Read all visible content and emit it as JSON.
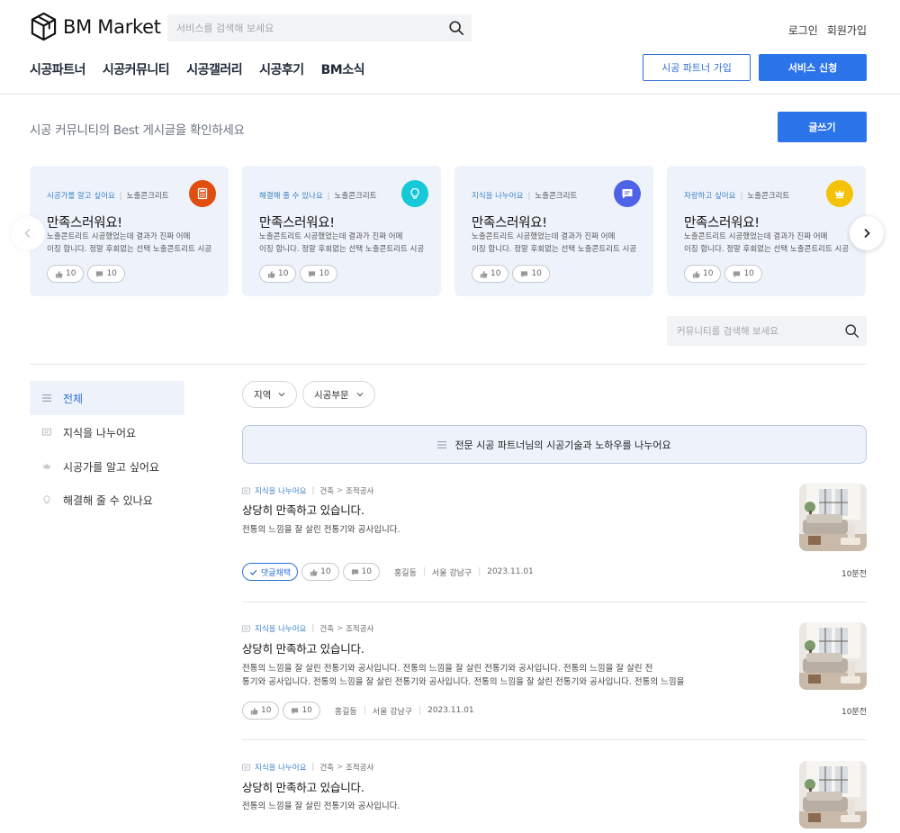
{
  "header": {
    "logo_text": "BM Market",
    "search_placeholder": "서비스를 검색해 보세요",
    "login": "로그인",
    "signup": "회원가입",
    "nav": [
      "시공파트너",
      "시공커뮤니티",
      "시공갤러리",
      "시공후기",
      "BM소식"
    ],
    "partner_button": "시공 파트너 가입",
    "service_button": "서비스 신청"
  },
  "best": {
    "title": "시공 커뮤니티의 Best 게시글을 확인하세요",
    "write_button": "글쓰기",
    "cards": [
      {
        "category": "시공가를 알고 싶어요",
        "tag": "노출콘크리트",
        "icon": "calculator-icon",
        "icon_color": "#e04f10",
        "title": "만족스러워요!",
        "line1": "노출콘트리트 시공했었는데 결과가 진짜 어메",
        "line2": "이징 합니다. 정말 후회없는 선택 노출콘트리트 시공",
        "likes": "10",
        "comments": "10"
      },
      {
        "category": "해결해 줄 수 있나요",
        "tag": "노출콘크리트",
        "icon": "lightbulb-icon",
        "icon_color": "#16c8d8",
        "title": "만족스러워요!",
        "line1": "노출콘트리트 시공했었는데 결과가 진짜 어메",
        "line2": "이징 합니다. 정말 후회없는 선택 노출콘트리트 시공",
        "likes": "10",
        "comments": "10"
      },
      {
        "category": "지식을 나누어요",
        "tag": "노출콘크리트",
        "icon": "chat-icon",
        "icon_color": "#4f63e6",
        "title": "만족스러워요!",
        "line1": "노출콘트리트 시공했었는데 결과가 진짜 어메",
        "line2": "이징 합니다. 정말 후회없는 선택 노출콘트리트 시공",
        "likes": "10",
        "comments": "10"
      },
      {
        "category": "자랑하고 싶어요",
        "tag": "노출콘크리트",
        "icon": "crown-icon",
        "icon_color": "#f5c20a",
        "title": "만족스러워요!",
        "line1": "노출콘트리트 시공했었는데 결과가 진짜 어메",
        "line2": "이징 합니다. 정말 후회없는 선택 노출콘트리트 시공",
        "likes": "10",
        "comments": "10"
      }
    ]
  },
  "community_search_placeholder": "커뮤니티를 검색해 보세요",
  "sidebar": {
    "items": [
      {
        "label": "전체",
        "active": true
      },
      {
        "label": "지식을 나누어요"
      },
      {
        "label": "시공가를 알고 싶어요"
      },
      {
        "label": "해결해 줄 수 있나요"
      }
    ]
  },
  "filters": {
    "region": "지역",
    "category": "시공부문"
  },
  "banner": "전문 시공 파트너님의 시공기술과 노하우를 나누어요",
  "posts": [
    {
      "category": "지식을 나누어요",
      "tag1": "건축",
      "arrow": ">",
      "tag2": "조적공사",
      "title": "상당히 만족하고 있습니다.",
      "line1": "전통의 느낌을 잘 살린 전통기와 공사입니다.",
      "line2": "",
      "adopted": "댓글채택",
      "likes": "10",
      "comments": "10",
      "author": "홍길동",
      "location": "서울 강남구",
      "date": "2023.11.01",
      "time": "10분전"
    },
    {
      "category": "지식을 나누어요",
      "tag1": "건축",
      "arrow": ">",
      "tag2": "조적공사",
      "title": "상당히 만족하고 있습니다.",
      "line1": "전통의 느낌을 잘 살린 전통기와 공사입니다. 전통의 느낌을 잘 살린 전통기와 공사입니다. 전통의 느낌을 잘 살린 전",
      "line2": "통기와 공사입니다. 전통의 느낌을 잘 살린 전통기와 공사입니다. 전통의 느낌을 잘 살린 전통기와 공사입니다. 전통의 느낌을",
      "likes": "10",
      "comments": "10",
      "author": "홍길동",
      "location": "서울 강남구",
      "date": "2023.11.01",
      "time": "10분전"
    },
    {
      "category": "지식을 나누어요",
      "tag1": "건축",
      "arrow": ">",
      "tag2": "조적공사",
      "title": "상당히 만족하고 있습니다.",
      "line1": "전통의 느낌을 잘 살린 전통기와 공사입니다.",
      "line2": ""
    }
  ],
  "colors": {
    "accent": "#2b74ea",
    "card_bg": "#eef3fb",
    "link": "#3b82c4"
  }
}
